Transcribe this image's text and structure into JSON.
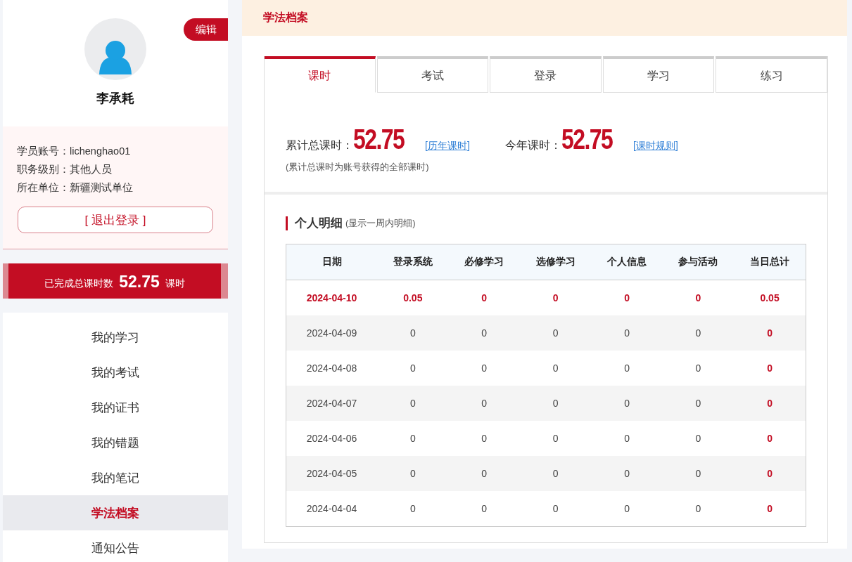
{
  "profile": {
    "edit_button": "编辑",
    "name": "李承耗",
    "info": [
      "学员账号：lichenghao01",
      "职务级别：其他人员",
      "所在单位：新疆测试单位"
    ],
    "logout_button": "[ 退出登录 ]"
  },
  "total_banner": {
    "label": "已完成总课时数",
    "value": "52.75",
    "unit": "课时"
  },
  "menu": [
    {
      "label": "我的学习",
      "selected": false
    },
    {
      "label": "我的考试",
      "selected": false
    },
    {
      "label": "我的证书",
      "selected": false
    },
    {
      "label": "我的错题",
      "selected": false
    },
    {
      "label": "我的笔记",
      "selected": false
    },
    {
      "label": "学法档案",
      "selected": true
    },
    {
      "label": "通知公告",
      "selected": false
    }
  ],
  "page_title": "学法档案",
  "tabs": [
    {
      "label": "课时",
      "selected": true
    },
    {
      "label": "考试",
      "selected": false
    },
    {
      "label": "登录",
      "selected": false
    },
    {
      "label": "学习",
      "selected": false
    },
    {
      "label": "练习",
      "selected": false
    }
  ],
  "summary": {
    "stats": [
      {
        "label": "累计总课时：",
        "value": "52.75",
        "link": "[历年课时]"
      },
      {
        "label": "今年课时：",
        "value": "52.75",
        "link": "[课时规则]"
      }
    ],
    "note": "(累计总课时为账号获得的全部课时)"
  },
  "detail": {
    "title": "个人明细",
    "subtitle": "(显示一周内明细)",
    "table": {
      "columns": [
        "日期",
        "登录系统",
        "必修学习",
        "选修学习",
        "个人信息",
        "参与活动",
        "当日总计"
      ],
      "rows": [
        {
          "highlighted": true,
          "cells": [
            "2024-04-10",
            "0.05",
            "0",
            "0",
            "0",
            "0",
            "0.05"
          ]
        },
        {
          "highlighted": false,
          "cells": [
            "2024-04-09",
            "0",
            "0",
            "0",
            "0",
            "0",
            "0"
          ]
        },
        {
          "highlighted": false,
          "cells": [
            "2024-04-08",
            "0",
            "0",
            "0",
            "0",
            "0",
            "0"
          ]
        },
        {
          "highlighted": false,
          "cells": [
            "2024-04-07",
            "0",
            "0",
            "0",
            "0",
            "0",
            "0"
          ]
        },
        {
          "highlighted": false,
          "cells": [
            "2024-04-06",
            "0",
            "0",
            "0",
            "0",
            "0",
            "0"
          ]
        },
        {
          "highlighted": false,
          "cells": [
            "2024-04-05",
            "0",
            "0",
            "0",
            "0",
            "0",
            "0"
          ]
        },
        {
          "highlighted": false,
          "cells": [
            "2024-04-04",
            "0",
            "0",
            "0",
            "0",
            "0",
            "0"
          ]
        }
      ]
    }
  }
}
